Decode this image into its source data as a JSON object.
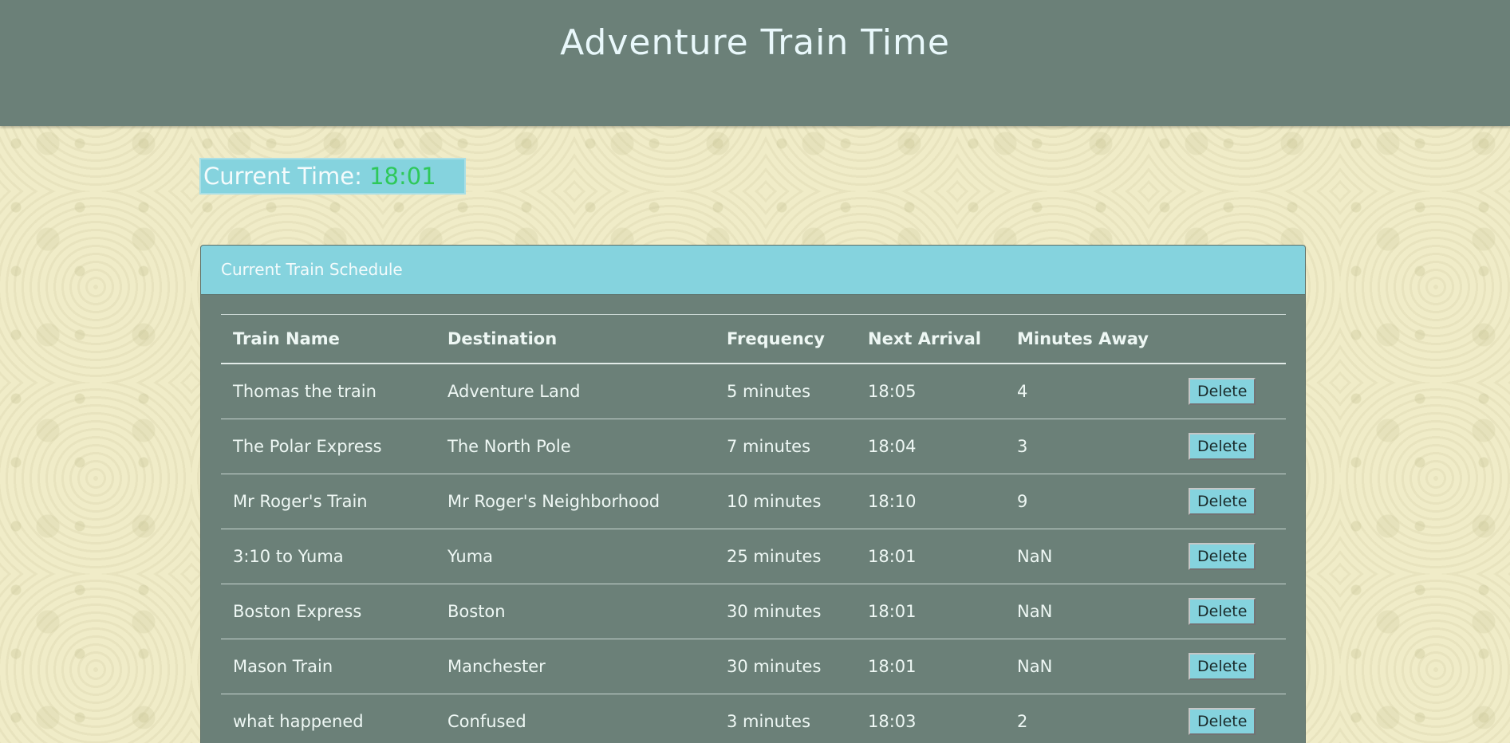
{
  "header": {
    "title": "Adventure Train Time"
  },
  "clock": {
    "label": "Current Time: ",
    "time": "18:01"
  },
  "schedule": {
    "heading": "Current Train Schedule",
    "columns": [
      "Train Name",
      "Destination",
      "Frequency",
      "Next Arrival",
      "Minutes Away"
    ],
    "delete_label": "Delete",
    "rows": [
      {
        "name": "Thomas the train",
        "destination": "Adventure Land",
        "frequency": "5 minutes",
        "next": "18:05",
        "away": "4"
      },
      {
        "name": "The Polar Express",
        "destination": "The North Pole",
        "frequency": "7 minutes",
        "next": "18:04",
        "away": "3"
      },
      {
        "name": "Mr Roger's Train",
        "destination": "Mr Roger's Neighborhood",
        "frequency": "10 minutes",
        "next": "18:10",
        "away": "9"
      },
      {
        "name": "3:10 to Yuma",
        "destination": "Yuma",
        "frequency": "25 minutes",
        "next": "18:01",
        "away": "NaN"
      },
      {
        "name": "Boston Express",
        "destination": "Boston",
        "frequency": "30 minutes",
        "next": "18:01",
        "away": "NaN"
      },
      {
        "name": "Mason Train",
        "destination": "Manchester",
        "frequency": "30 minutes",
        "next": "18:01",
        "away": "NaN"
      },
      {
        "name": "what happened",
        "destination": "Confused",
        "frequency": "3 minutes",
        "next": "18:03",
        "away": "2"
      }
    ]
  },
  "colors": {
    "header_bg": "#6b8078",
    "accent": "#85d3de",
    "clock_time": "#2ec85a",
    "page_bg": "#f0ecc8"
  }
}
